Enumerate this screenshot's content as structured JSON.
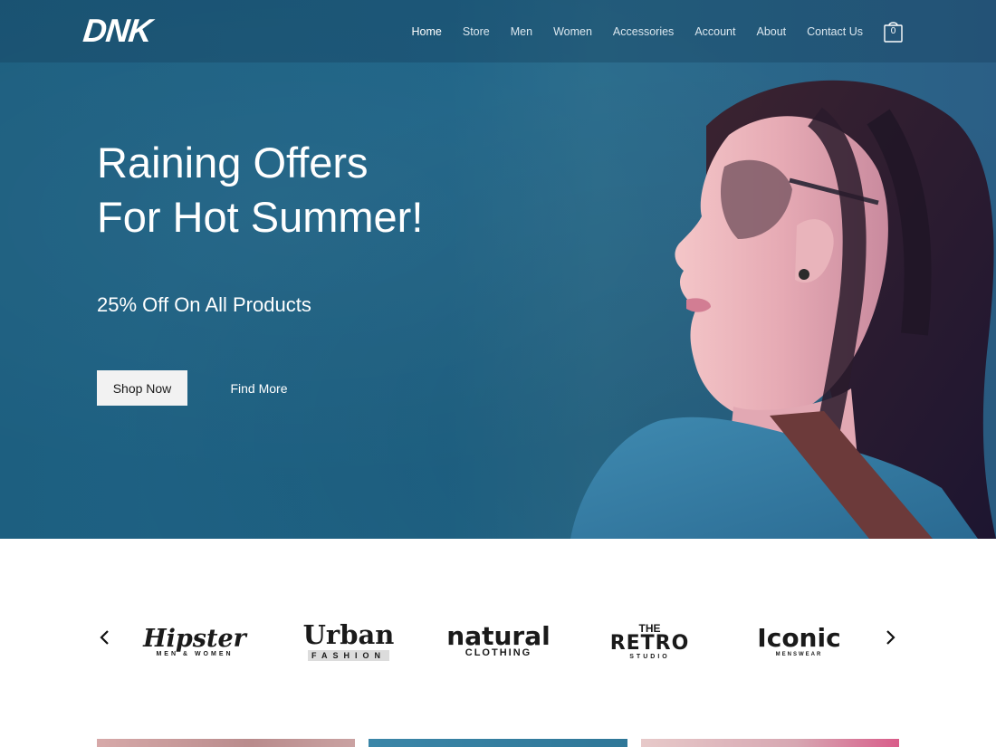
{
  "header": {
    "logo": "DNK",
    "nav": [
      {
        "label": "Home",
        "active": true
      },
      {
        "label": "Store",
        "active": false
      },
      {
        "label": "Men",
        "active": false
      },
      {
        "label": "Women",
        "active": false
      },
      {
        "label": "Accessories",
        "active": false
      },
      {
        "label": "Account",
        "active": false
      },
      {
        "label": "About",
        "active": false
      },
      {
        "label": "Contact Us",
        "active": false
      }
    ],
    "cart_count": "0"
  },
  "hero": {
    "title_line1": "Raining Offers",
    "title_line2": "For Hot Summer!",
    "subtitle": "25% Off On All Products",
    "primary_button": "Shop Now",
    "secondary_button": "Find More"
  },
  "brands": {
    "items": [
      {
        "name": "Hipster",
        "tagline": "MEN & WOMEN"
      },
      {
        "name": "Urban",
        "tagline": "FASHION"
      },
      {
        "name": "natural",
        "tagline": "CLOTHING"
      },
      {
        "name": "RETRO",
        "prefix": "THE",
        "tagline": "STUDIO"
      },
      {
        "name": "Iconic",
        "tagline": "MENSWEAR"
      }
    ],
    "prev_icon": "chevron-left-icon",
    "next_icon": "chevron-right-icon"
  },
  "colors": {
    "hero_blue": "#1f6487",
    "nav_text": "#dbe7ef",
    "button_bg": "#f2f2f2"
  }
}
